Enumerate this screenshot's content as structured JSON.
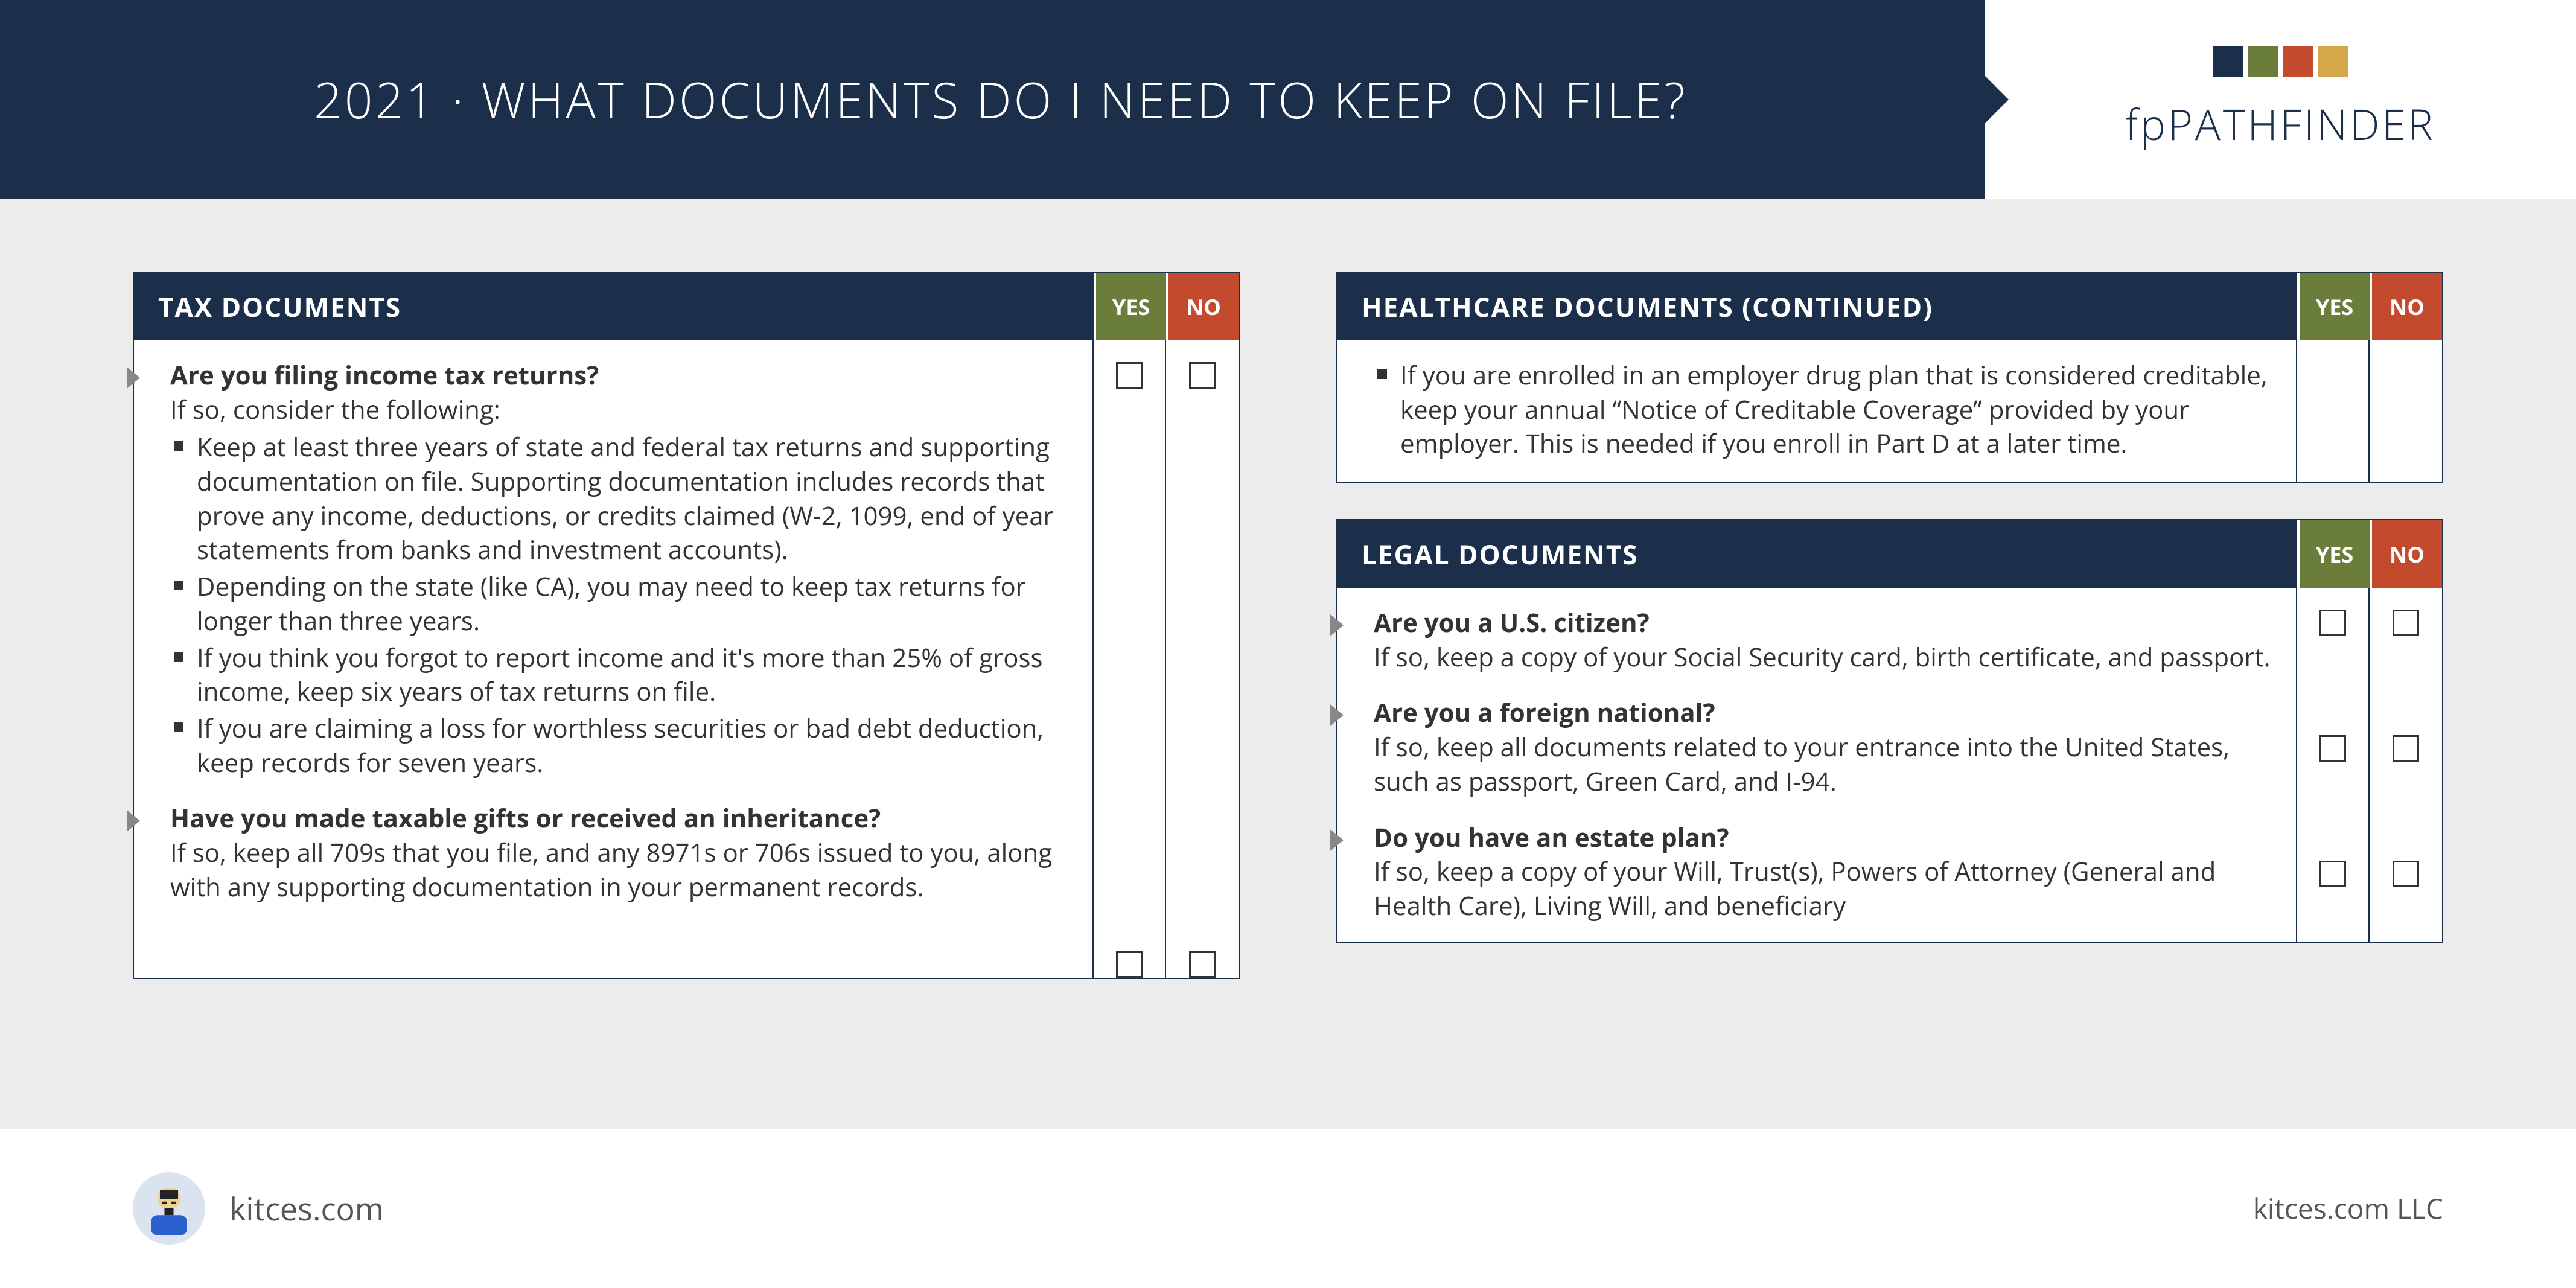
{
  "header": {
    "title": "2021 · WHAT DOCUMENTS DO I NEED TO KEEP ON FILE?",
    "brand_fp": "fp",
    "brand_pf": "PATHFINDER"
  },
  "labels": {
    "yes": "YES",
    "no": "NO"
  },
  "sections": {
    "tax": {
      "title": "TAX DOCUMENTS",
      "item1": {
        "q": "Are you filing income tax returns?",
        "sub": "If so, consider the following:",
        "b1": "Keep at least three years of state and federal tax returns and supporting documentation on file. Supporting documentation includes records that prove any income, deductions, or credits claimed (W-2, 1099, end of year statements from banks and investment accounts).",
        "b2": "Depending on the state (like CA), you may need to keep tax returns for longer than three years.",
        "b3": "If you think you forgot to report income and it's more than 25% of gross income, keep six years of tax returns on file.",
        "b4": "If you are claiming a loss for worthless securities or bad debt deduction, keep records for seven years."
      },
      "item2": {
        "q": "Have you made taxable gifts or received an inheritance?",
        "sub": "If so, keep all 709s that you file, and any 8971s or 706s issued to you, along with any supporting documentation in your permanent records."
      }
    },
    "healthcare": {
      "title": "HEALTHCARE DOCUMENTS (CONTINUED)",
      "b1": "If you are enrolled in an employer drug plan that is considered creditable, keep your annual “Notice of Creditable Coverage” provided by your employer. This is needed if you enroll in Part D at a later time."
    },
    "legal": {
      "title": "LEGAL DOCUMENTS",
      "item1": {
        "q": "Are you a U.S. citizen?",
        "sub": "If so, keep a copy of your Social Security card, birth certificate, and passport."
      },
      "item2": {
        "q": "Are you a foreign national?",
        "sub": "If so, keep all documents related to your entrance into the United States, such as passport, Green Card, and I-94."
      },
      "item3": {
        "q": "Do you have an estate plan?",
        "sub": "If so, keep a copy of your Will, Trust(s), Powers of Attorney (General and Health Care), Living Will, and beneficiary"
      }
    }
  },
  "footer": {
    "site": "kitces.com",
    "llc": "kitces.com LLC"
  }
}
